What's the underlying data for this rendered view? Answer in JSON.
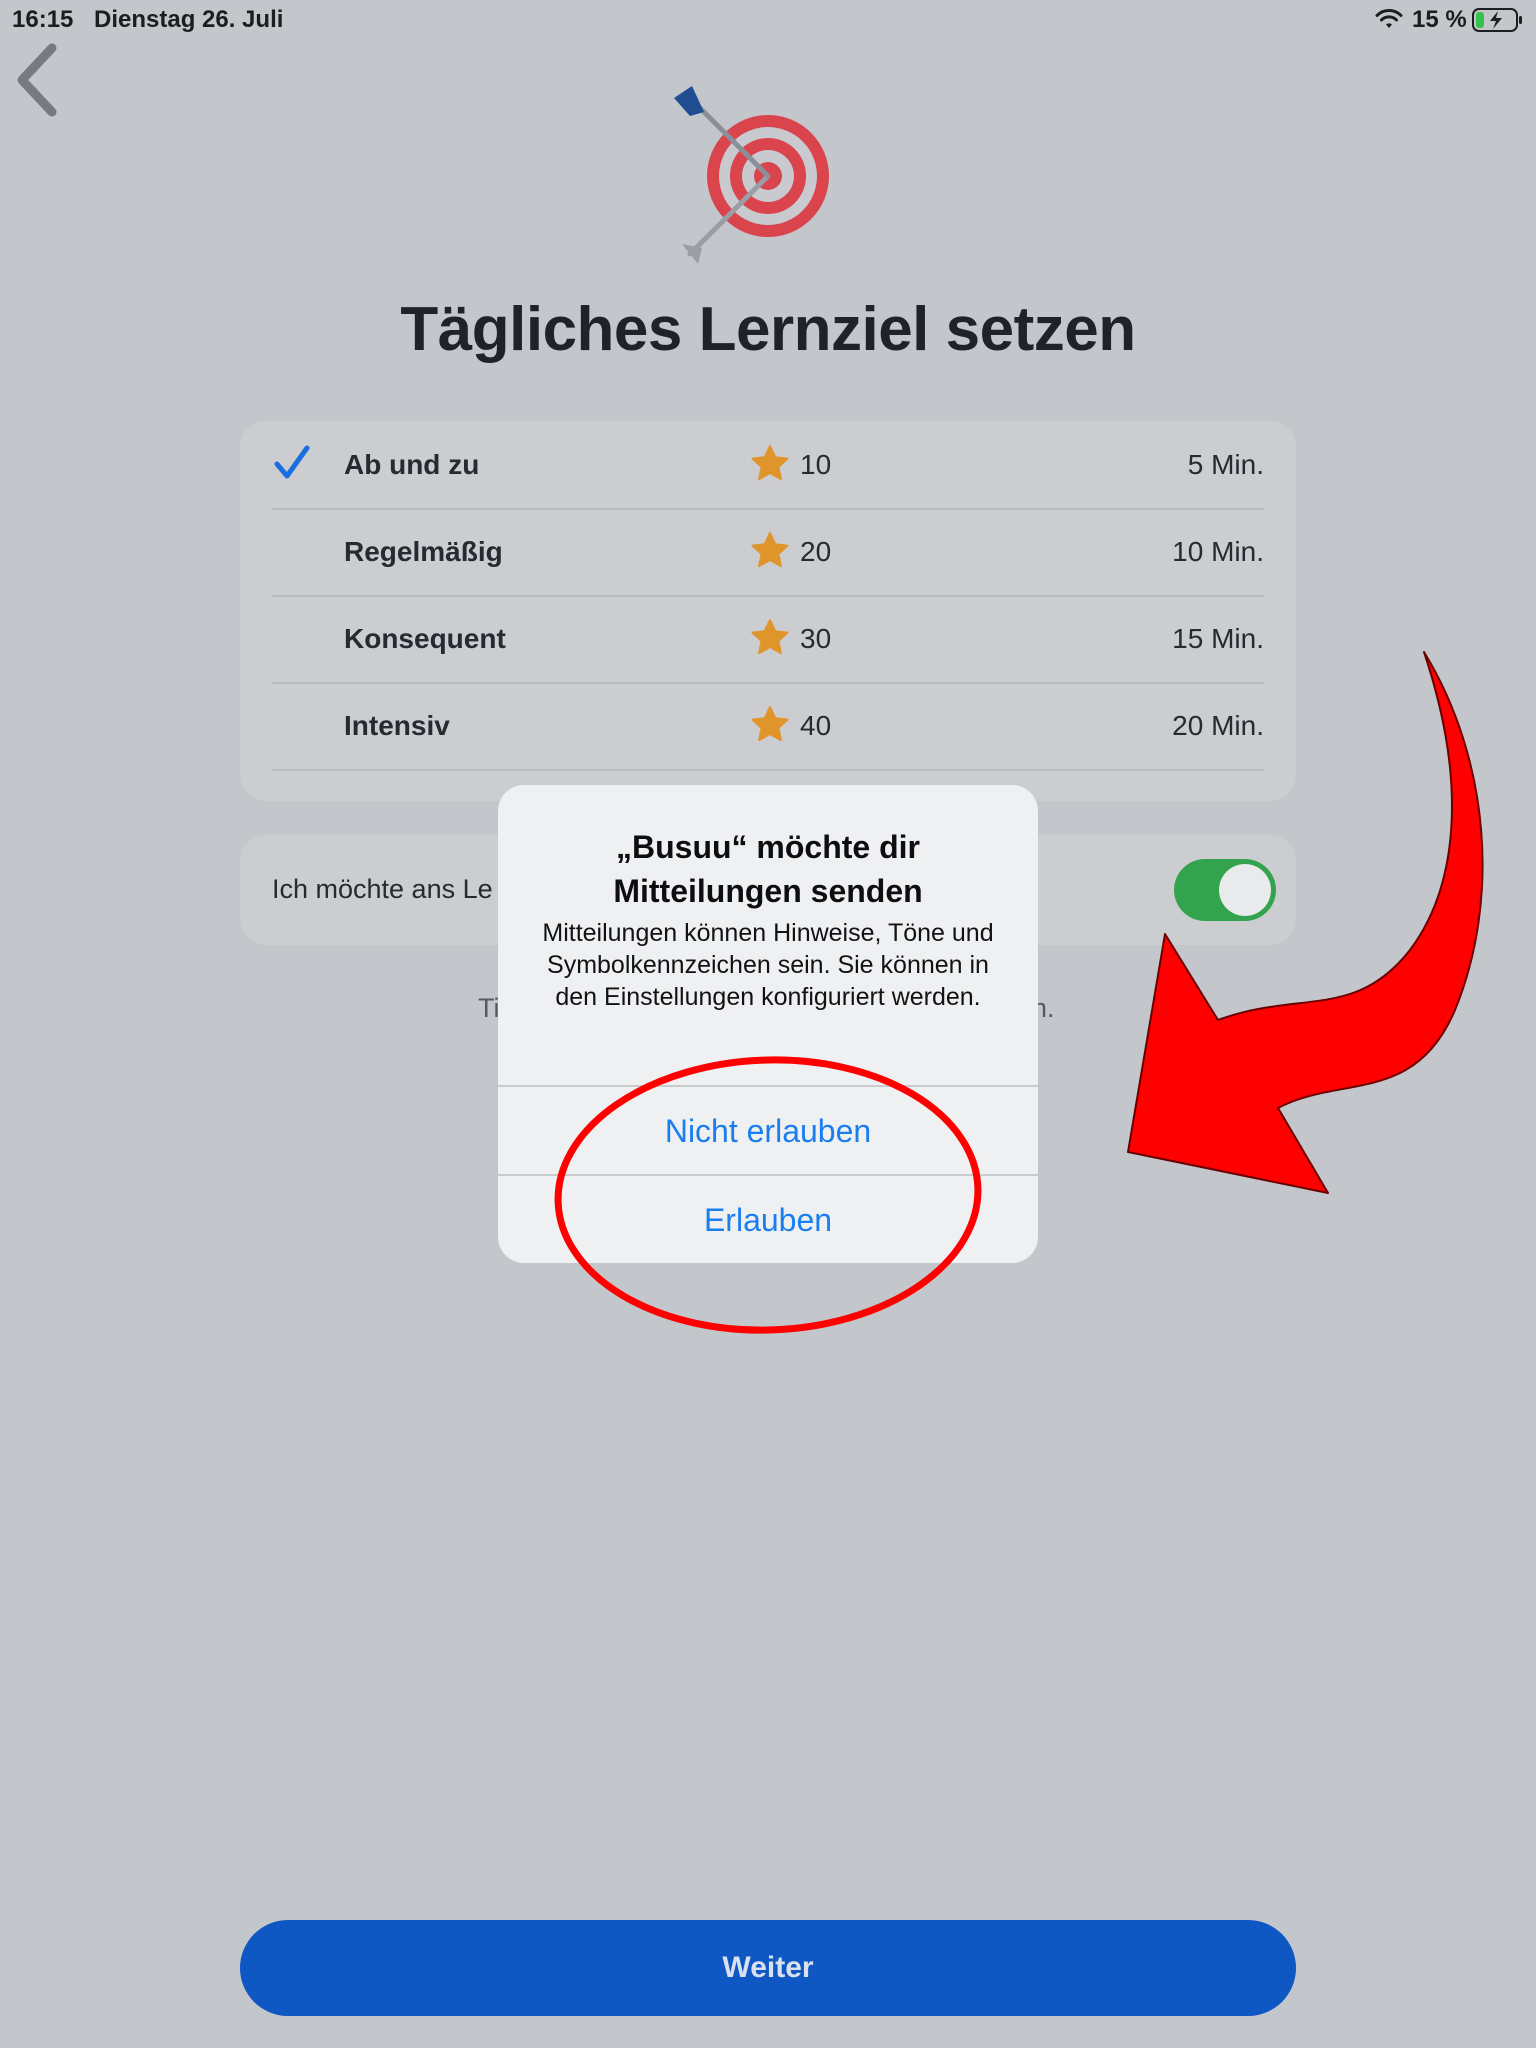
{
  "status_bar": {
    "time": "16:15",
    "date": "Dienstag 26. Juli",
    "battery": "15 %"
  },
  "page": {
    "title": "Tägliches Lernziel setzen",
    "goals": [
      {
        "name": "Ab und zu",
        "points": "10",
        "minutes": "5 Min.",
        "selected": true
      },
      {
        "name": "Regelmäßig",
        "points": "20",
        "minutes": "10 Min.",
        "selected": false
      },
      {
        "name": "Konsequent",
        "points": "30",
        "minutes": "15 Min.",
        "selected": false
      },
      {
        "name": "Intensiv",
        "points": "40",
        "minutes": "20 Min.",
        "selected": false
      }
    ],
    "reminder_label": "Ich möchte ans Le",
    "reminder_enabled": true,
    "hint_left": "Ti",
    "hint_right": "n.",
    "continue_label": "Weiter"
  },
  "alert": {
    "title": "„Busuu“ möchte dir Mitteilungen senden",
    "message": "Mitteilungen können Hinweise, Töne und Symbolkennzeichen sein. Sie können in den Einstellungen konfiguriert werden.",
    "deny_label": "Nicht erlauben",
    "allow_label": "Erlauben"
  },
  "colors": {
    "accent_blue": "#1a7ef0",
    "primary_button": "#0f57c3",
    "toggle_on": "#33a34e",
    "star": "#e0952a",
    "annotation_red": "#ff0000"
  },
  "icons": [
    "back-chevron-icon",
    "target-arrow-icon",
    "checkmark-icon",
    "star-icon",
    "wifi-icon",
    "battery-charging-icon"
  ]
}
